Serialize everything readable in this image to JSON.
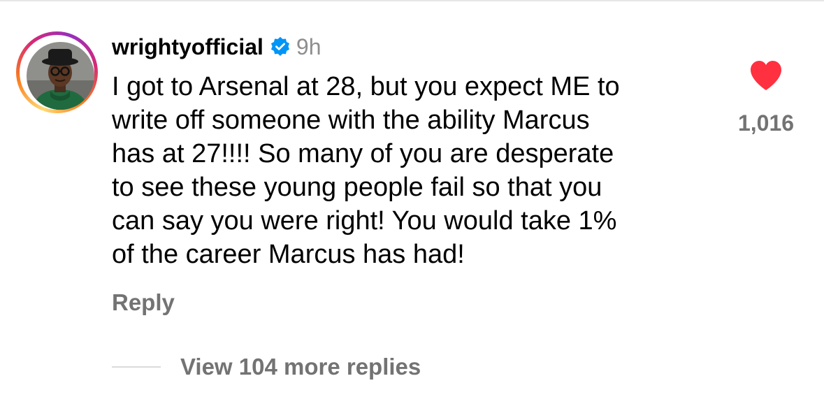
{
  "comment": {
    "username": "wrightyofficial",
    "verified_icon": "verified-badge-icon",
    "time": "9h",
    "text_lines": [
      "I got to Arsenal at 28, but you expect ME to",
      "write off someone with the ability Marcus",
      "has at 27!!!! So many of you are desperate",
      "to see these young people fail so that you",
      "can say you were right! You would take 1%",
      "of the career Marcus has had!"
    ],
    "reply_label": "Reply",
    "view_replies_label": "View 104 more replies"
  },
  "like": {
    "icon": "heart-filled-icon",
    "count": "1,016",
    "color": "#ff3040"
  },
  "colors": {
    "verified_blue": "#0095f6",
    "muted_text": "#737373",
    "time_text": "#8e8e8e"
  }
}
